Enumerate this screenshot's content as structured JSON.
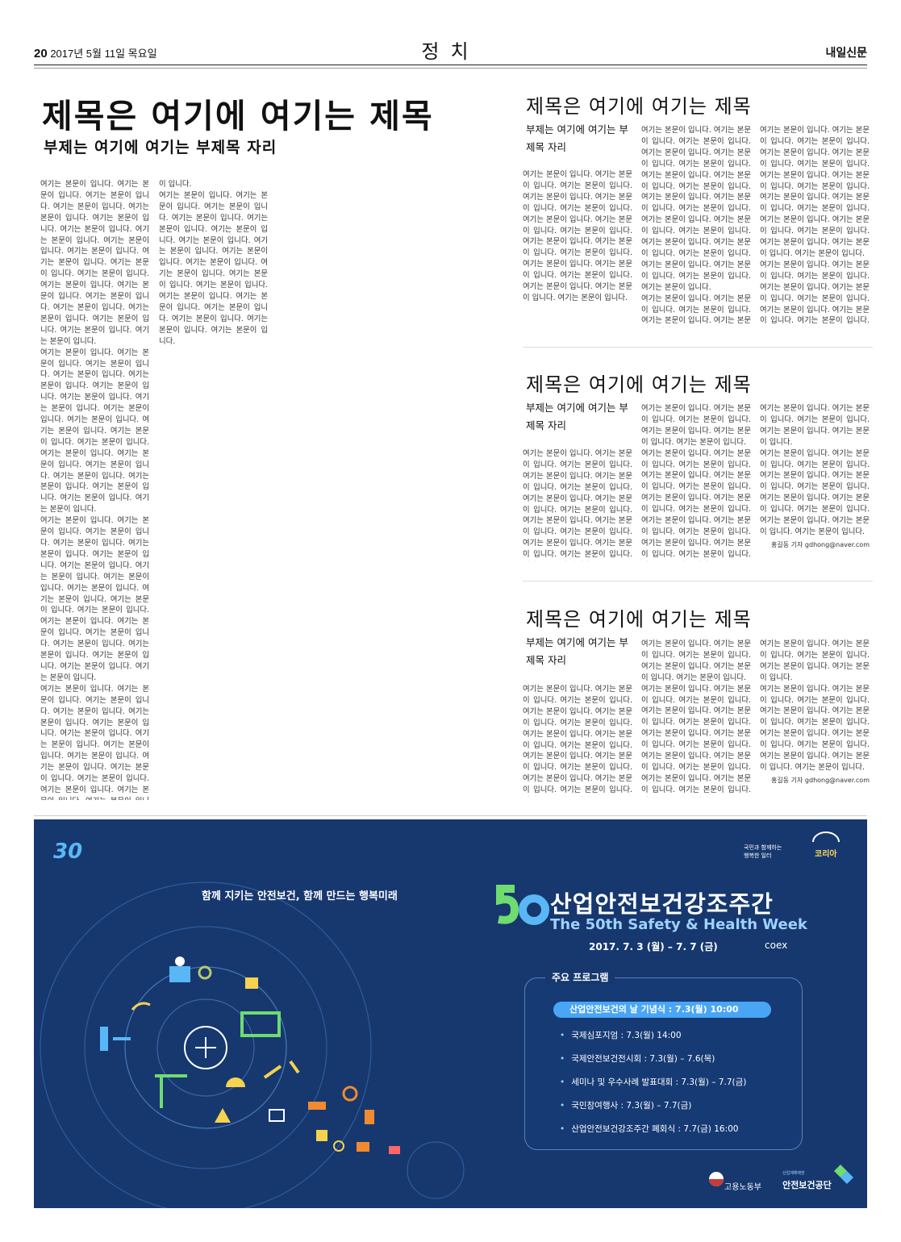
{
  "masthead": {
    "page_number": "20",
    "date": "2017년 5월 11일 목요일",
    "section": "정치",
    "paper_name": "내일신문"
  },
  "main_article": {
    "title": "제목은 여기에 여기는 제목",
    "subtitle": "부제는 여기에 여기는 부제목 자리",
    "col1": "여기는 본문이 입니다. 여기는 본문이 입니다. 여기는 본문이 입니다. 여기는 본문이 입니다. 여기는 본문이 입니다. 여기는 본문이 입니다. 여기는 본문이 입니다. 여기는 본문이 입니다. 여기는 본문이 입니다. 여기는 본문이 입니다. 여기는 본문이 입니다. 여기는 본문이 입니다. 여기는 본문이 입니다. 여기는 본문이 입니다. 여기는 본문이 입니다. 여기는 본문이 입니다. 여기는 본문이 입니다. 여기는 본문이 입니다. 여기는 본문이 입니다. 여기는 본문이 입니다. 여기는 본문이 입니다.\n여기는 본문이 입니다. 여기는 본문이 입니다. 여기는 본문이 입니다. 여기는 본문이 입니다. 여기는 본문이 입니다. 여기는 본문이 입니다. 여기는 본문이 입니다. 여기는 본문이 입니다. 여기는 본문이 입니다. 여기는 본문이 입니다. 여기는 본문이 입니다. 여기는 본문이 입니다. 여기는 본문이 입니다. 여기는 본문이 입니다. 여기는 본문이 입니다. 여기는 본문이 입니다. 여기는 본문이 입니다. 여기는 본문이 입니다. 여기는 본문이 입니다. 여기는 본문이 입니다. 여기는 본문이 입니다.\n여기는 본문이 입니다. 여기는 본문이 입니다. 여기는 본문이 입니다. 여기는 본문이 입니다. 여기는 본문이 입니다. 여기는 본문이 입니다. 여기는 본문이 입니다. 여기는 본문이 입니다. 여기는 본문이 입니다. 여기는 본문이 입니다. 여기는 본문이 입니다. 여기는 본문이 입니다. 여기는 본문이 입니다. 여기는 본문이 입니다. 여기는 본문이 입니다. 여기는 본문이 입니다. 여기는 본문이 입니다. 여기는 본문이 입니다. 여기는 본문이 입니다. 여기는 본문이 입니다. 여기는 본문이 입니다.\n여기는 본문이 입니다. 여기는 본문이 입니다. 여기는 본문이 입니다. 여기는 본문이 입니다. 여기는 본문이 입니다. 여기는 본문이 입니다. 여기는 본문이 입니다. 여기는 본문이 입니다. 여기는 본문이 입니다. 여기는 본문이 입니다. 여기는 본문이 입니다. 여기는 본문이 입니다. 여기는 본문이 입니다. 여기는 본문이 입니다. 여기는 본문이 입니다. 여기는 본문이 입니다. 여기는 본문이",
    "col2": "이 입니다.\n여기는 본문이 입니다. 여기는 본문이 입니다. 여기는 본문이 입니다. 여기는 본문이 입니다. 여기는 본문이 입니다. 여기는 본문이 입니다. 여기는 본문이 입니다. 여기는 본문이 입니다. 여기는 본문이 입니다. 여기는 본문이 입니다. 여기는 본문이 입니다. 여기는 본문이 입니다. 여기는 본문이 입니다. 여기는 본문이 입니다. 여기는 본문이 입니다. 여기는 본문이 입니다. 여기는 본문이 입니다. 여기는 본문이 입니다. 여기는 본문이 입니다."
  },
  "side_articles": [
    {
      "title": "제목은 여기에 여기는 제목",
      "subtitle": "부제는 여기에 여기는 부제목 자리",
      "col1": "여기는 본문이 입니다. 여기는 본문이 입니다. 여기는 본문이 입니다. 여기는 본문이 입니다. 여기는 본문이 입니다. 여기는 본문이 입니다. 여기는 본문이 입니다. 여기는 본문이 입니다. 여기는 본문이 입니다. 여기는 본문이 입니다. 여기는 본문이 입니다. 여기는 본문이 입니다. 여기는 본문이 입니다. 여기는 본문이 입니다. 여기는 본문이 입니다. 여기는 본문이 입니다. 여기는 본문이 입니다. 여기는 본문이 입니다.",
      "col2": "여기는 본문이 입니다. 여기는 본문이 입니다. 여기는 본문이 입니다. 여기는 본문이 입니다. 여기는 본문이 입니다. 여기는 본문이 입니다. 여기는 본문이 입니다. 여기는 본문이 입니다. 여기는 본문이 입니다. 여기는 본문이 입니다. 여기는 본문이 입니다. 여기는 본문이 입니다. 여기는 본문이 입니다. 여기는 본문이 입니다. 여기는 본문이 입니다. 여기는 본문이 입니다. 여기는 본문이 입니다. 여기는 본문이 입니다. 여기는 본문이 입니다. 여기는 본문이 입니다. 여기는 본문이 입니다. 여기는 본문이 입니다.\n여기는 본문이 입니다. 여기는 본문이 입니다. 여기는 본문이 입니다. 여기는 본문이 입니다. 여기는 본문이 입니다.",
      "col3": "여기는 본문이 입니다. 여기는 본문이 입니다. 여기는 본문이 입니다. 여기는 본문이 입니다. 여기는 본문이 입니다. 여기는 본문이 입니다. 여기는 본문이 입니다. 여기는 본문이 입니다. 여기는 본문이 입니다. 여기는 본문이 입니다. 여기는 본문이 입니다. 여기는 본문이 입니다. 여기는 본문이 입니다. 여기는 본문이 입니다. 여기는 본문이 입니다. 여기는 본문이 입니다. 여기는 본문이 입니다. 여기는 본문이 입니다.\n여기는 본문이 입니다. 여기는 본문이 입니다. 여기는 본문이 입니다. 여기는 본문이 입니다. 여기는 본문이 입니다. 여기는 본문이 입니다. 여기는 본문이 입니다. 여기는 본문이 입니다. 여기는 본문이 입니다. 여기는 본문이 입니다.",
      "byline": ""
    },
    {
      "title": "제목은 여기에 여기는 제목",
      "subtitle": "부제는 여기에 여기는 부제목 자리",
      "col1": "여기는 본문이 입니다. 여기는 본문이 입니다. 여기는 본문이 입니다. 여기는 본문이 입니다. 여기는 본문이 입니다. 여기는 본문이 입니다. 여기는 본문이 입니다. 여기는 본문이 입니다. 여기는 본문이 입니다. 여기는 본문이 입니다. 여기는 본문이 입니다. 여기는 본문이 입니다. 여기는 본문이 입니다. 여기는 본문이 입니다. 여기는 본문이 입니다. 여기는 본문이 입니다.",
      "col2": "여기는 본문이 입니다. 여기는 본문이 입니다. 여기는 본문이 입니다. 여기는 본문이 입니다. 여기는 본문이 입니다. 여기는 본문이 입니다.\n여기는 본문이 입니다. 여기는 본문이 입니다. 여기는 본문이 입니다. 여기는 본문이 입니다. 여기는 본문이 입니다. 여기는 본문이 입니다. 여기는 본문이 입니다. 여기는 본문이 입니다. 여기는 본문이 입니다. 여기는 본문이 입니다. 여기는 본문이 입니다. 여기는 본문이 입니다. 여기는 본문이 입니다. 여기는 본문이 입니다. 여기는 본문이 입니다. 여기는 본문이 입니다.",
      "col3": "여기는 본문이 입니다. 여기는 본문이 입니다. 여기는 본문이 입니다. 여기는 본문이 입니다. 여기는 본문이 입니다.\n여기는 본문이 입니다. 여기는 본문이 입니다. 여기는 본문이 입니다. 여기는 본문이 입니다. 여기는 본문이 입니다. 여기는 본문이 입니다. 여기는 본문이 입니다. 여기는 본문이 입니다. 여기는 본문이 입니다. 여기는 본문이 입니다. 여기는 본문이 입니다. 여기는 본문이 입니다.",
      "byline": "홍길동 기자 gdhong@naver.com"
    },
    {
      "title": "제목은 여기에 여기는 제목",
      "subtitle": "부제는 여기에 여기는 부제목 자리",
      "col1": "여기는 본문이 입니다. 여기는 본문이 입니다. 여기는 본문이 입니다. 여기는 본문이 입니다. 여기는 본문이 입니다. 여기는 본문이 입니다. 여기는 본문이 입니다. 여기는 본문이 입니다. 여기는 본문이 입니다. 여기는 본문이 입니다. 여기는 본문이 입니다. 여기는 본문이 입니다. 여기는 본문이 입니다. 여기는 본문이 입니다. 여기는 본문이 입니다. 여기는 본문이 입니다.",
      "col2": "여기는 본문이 입니다. 여기는 본문이 입니다. 여기는 본문이 입니다. 여기는 본문이 입니다. 여기는 본문이 입니다. 여기는 본문이 입니다.\n여기는 본문이 입니다. 여기는 본문이 입니다. 여기는 본문이 입니다. 여기는 본문이 입니다. 여기는 본문이 입니다. 여기는 본문이 입니다. 여기는 본문이 입니다. 여기는 본문이 입니다. 여기는 본문이 입니다. 여기는 본문이 입니다. 여기는 본문이 입니다. 여기는 본문이 입니다. 여기는 본문이 입니다. 여기는 본문이 입니다. 여기는 본문이 입니다. 여기는 본문이 입니다.",
      "col3": "여기는 본문이 입니다. 여기는 본문이 입니다. 여기는 본문이 입니다. 여기는 본문이 입니다. 여기는 본문이 입니다.\n여기는 본문이 입니다. 여기는 본문이 입니다. 여기는 본문이 입니다. 여기는 본문이 입니다. 여기는 본문이 입니다. 여기는 본문이 입니다. 여기는 본문이 입니다. 여기는 본문이 입니다. 여기는 본문이 입니다. 여기는 본문이 입니다. 여기는 본문이 입니다. 여기는 본문이 입니다.",
      "byline": "홍길동 기자 gdhong@naver.com"
    }
  ],
  "ad": {
    "badge_30": "30",
    "slogan": "함께 지키는 안전보건, 함께 만드는 행복미래",
    "top_right_line1": "국민과 함께하는",
    "top_right_line2": "행복한 일터",
    "top_right_brand": "코리아",
    "title": "산업안전보건강조주간",
    "title_en": "The 50th Safety & Health Week",
    "date": "2017. 7. 3 (월) – 7. 7 (금)",
    "venue": "coex",
    "program_heading": "주요 프로그램",
    "program_highlight": "산업안전보건의 날 기념식 : 7.3(월) 10:00",
    "program_items": [
      "국제심포지엄 : 7.3(월) 14:00",
      "국제안전보건전시회 : 7.3(월) – 7.6(목)",
      "세미나 및 우수사례 발표대회 : 7.3(월) – 7.7(금)",
      "국민참여행사 : 7.3(월) – 7.7(금)",
      "산업안전보건강조주간 폐회식 : 7.7(금) 16:00"
    ],
    "org1": "고용노동부",
    "org2_small": "산업재해예방",
    "org2": "안전보건공단",
    "colors": {
      "background": "#16386f",
      "accent": "#4aa5f5"
    }
  }
}
